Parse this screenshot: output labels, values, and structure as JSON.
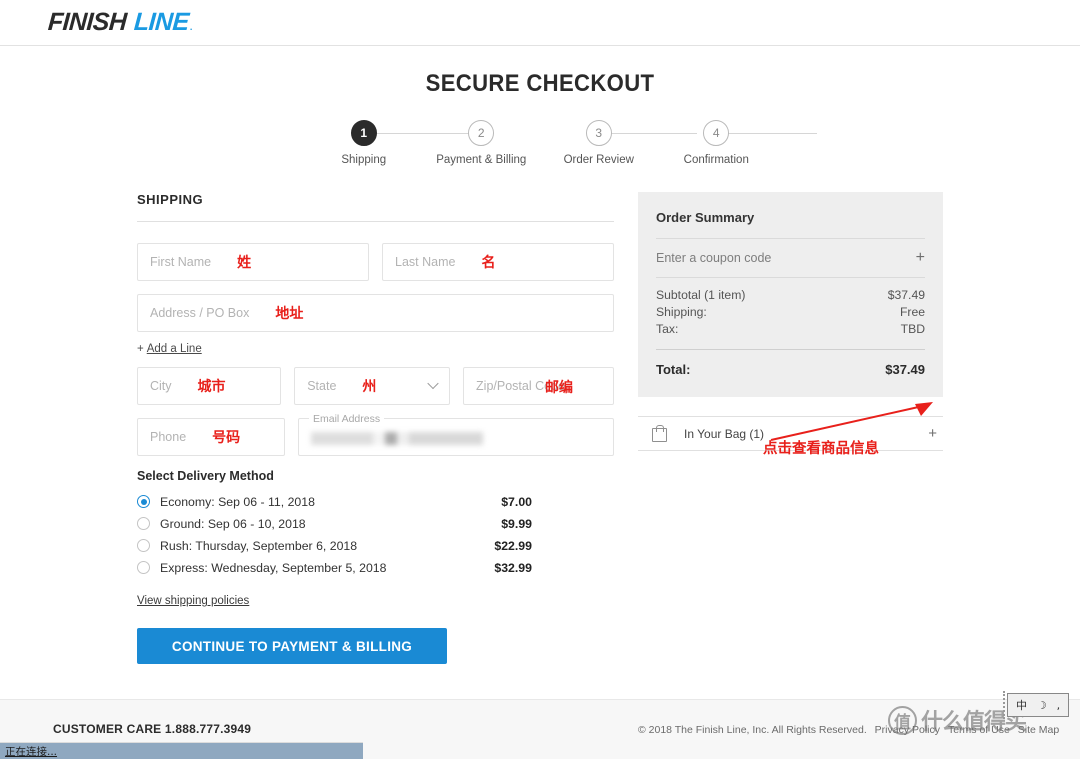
{
  "header": {
    "logo_first": "FINISH",
    "logo_second": "LINE",
    "logo_mark": "."
  },
  "page_title": "SECURE CHECKOUT",
  "stepper": {
    "steps": [
      {
        "number": "1",
        "label": "Shipping"
      },
      {
        "number": "2",
        "label": "Payment & Billing"
      },
      {
        "number": "3",
        "label": "Order Review"
      },
      {
        "number": "4",
        "label": "Confirmation"
      }
    ]
  },
  "shipping": {
    "section_title": "SHIPPING",
    "fields": {
      "first_name": {
        "placeholder": "First Name",
        "value": "",
        "annotation": "姓"
      },
      "last_name": {
        "placeholder": "Last Name",
        "value": "",
        "annotation": "名"
      },
      "address": {
        "placeholder": "Address / PO Box",
        "value": "",
        "annotation": "地址"
      },
      "city": {
        "placeholder": "City",
        "value": "",
        "annotation": "城市"
      },
      "state": {
        "placeholder": "State",
        "value": "",
        "annotation": "州"
      },
      "zip": {
        "placeholder": "Zip/Postal Code",
        "value": "",
        "annotation": "邮编"
      },
      "phone": {
        "placeholder": "Phone",
        "value": "",
        "annotation": "号码"
      },
      "email": {
        "label": "Email Address",
        "value": "",
        "redacted": true
      }
    },
    "add_line": {
      "plus": "+",
      "label": "Add a Line"
    }
  },
  "delivery": {
    "title": "Select Delivery Method",
    "options": [
      {
        "label": "Economy: Sep 06 - 11, 2018",
        "price": "$7.00",
        "selected": true
      },
      {
        "label": "Ground: Sep 06 - 10, 2018",
        "price": "$9.99",
        "selected": false
      },
      {
        "label": "Rush: Thursday, September 6, 2018",
        "price": "$22.99",
        "selected": false
      },
      {
        "label": "Express: Wednesday, September 5, 2018",
        "price": "$32.99",
        "selected": false
      }
    ],
    "policies_link": "View shipping policies"
  },
  "cta": {
    "label": "CONTINUE TO PAYMENT & BILLING",
    "color": "#1a8ad4"
  },
  "summary": {
    "title": "Order Summary",
    "coupon_placeholder": "Enter a coupon code",
    "coupon_plus": "+",
    "lines": [
      {
        "label": "Subtotal (1 item)",
        "value": "$37.49"
      },
      {
        "label": "Shipping:",
        "value": "Free"
      },
      {
        "label": "Tax:",
        "value": "TBD"
      }
    ],
    "total_label": "Total:",
    "total_value": "$37.49"
  },
  "bag": {
    "label": "In Your Bag (1)",
    "expand": "+",
    "annotation": "点击查看商品信息"
  },
  "footer": {
    "customer_care": "CUSTOMER CARE 1.888.777.3949",
    "copyright": "© 2018 The Finish Line, Inc. All Rights Reserved.",
    "links": [
      "Privacy Policy",
      "Terms of Use",
      "Site Map"
    ]
  },
  "watermark": {
    "circle": "值",
    "text": "什么值得买"
  },
  "ime": {
    "mode": "中",
    "shape": "☽",
    "punct": ","
  },
  "statusbar": {
    "text": "正在连接..."
  }
}
